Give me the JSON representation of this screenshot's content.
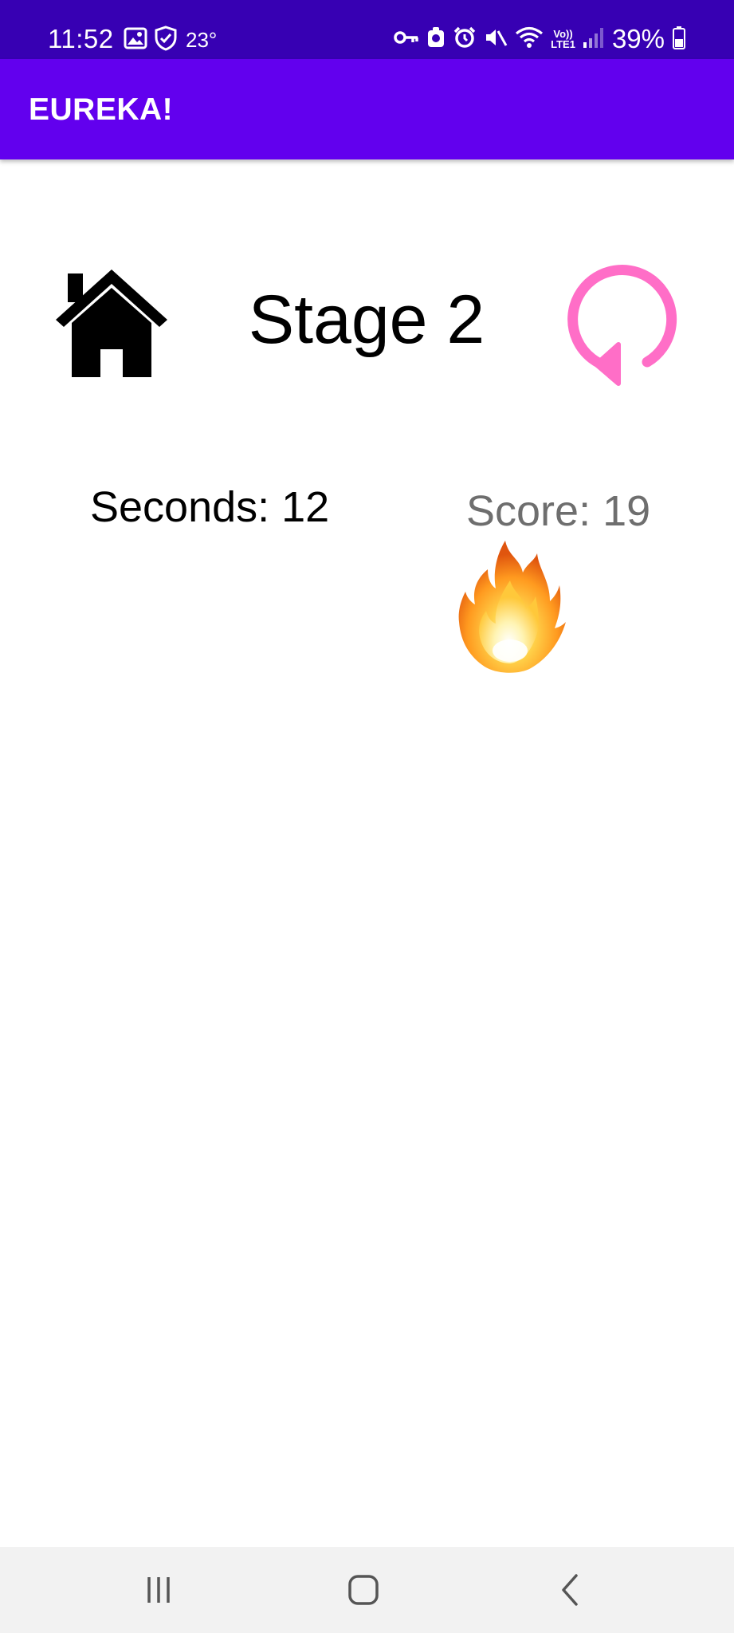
{
  "status_bar": {
    "time": "11:52",
    "temperature": "23°",
    "lte_label_top": "Vo))",
    "lte_label_bottom": "LTE1",
    "battery_percent": "39%",
    "left_icons": [
      "image-icon",
      "shield-check-icon"
    ],
    "right_icons": [
      "vpn-key-icon",
      "app-notification-icon",
      "alarm-icon",
      "mute-icon",
      "wifi-icon",
      "lte-icon",
      "signal-icon",
      "battery-icon"
    ]
  },
  "app_bar": {
    "title": "EUREKA!",
    "color": "#6200ee"
  },
  "game": {
    "stage_title": "Stage 2",
    "seconds_text": "Seconds: 12",
    "score_text": "Score: 19",
    "home_icon": "home-icon",
    "restart_icon": "restart-icon",
    "restart_color": "#ff6ec7",
    "sprite_icon": "fire-icon"
  },
  "nav_bar": {
    "buttons": [
      "recent-apps-icon",
      "home-circle-icon",
      "back-icon"
    ]
  }
}
